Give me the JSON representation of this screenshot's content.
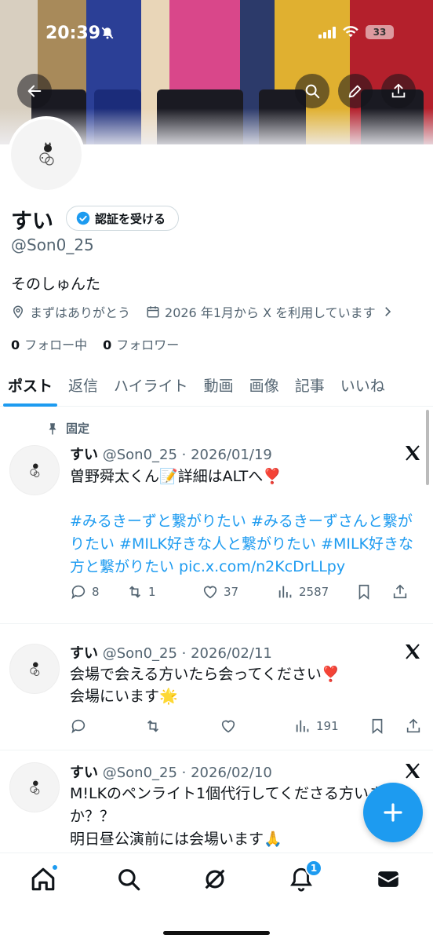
{
  "status": {
    "time": "20:39",
    "battery": "33"
  },
  "colors": {
    "accent": "#1d9bf0",
    "text": "#0f1419",
    "secondary": "#536471"
  },
  "profile": {
    "name": "すい",
    "verify_label": "認証を受ける",
    "handle": "@Son0_25",
    "bio": "そのしゅんた",
    "location": "まずはありがとう",
    "joined": "2026 年1月から X を利用しています",
    "following_count": "0",
    "following_label": "フォロー中",
    "followers_count": "0",
    "followers_label": "フォロワー"
  },
  "tabs": [
    {
      "label": "ポスト"
    },
    {
      "label": "返信"
    },
    {
      "label": "ハイライト"
    },
    {
      "label": "動画"
    },
    {
      "label": "画像"
    },
    {
      "label": "記事"
    },
    {
      "label": "いいね"
    }
  ],
  "posts": [
    {
      "pinned_label": "固定",
      "name": "すい",
      "handle_date": "@Son0_25 · 2026/01/19",
      "text": "曽野舜太くん📝詳細はALTへ❣️",
      "hashtags": "#みるきーずと繋がりたい #みるきーずさんと繋がりたい #MILK好きな人と繋がりたい #MILK好きな方と繋がりたい pic.x.com/n2KcDrLLpy",
      "replies": "8",
      "reposts": "1",
      "likes": "37",
      "views": "2587"
    },
    {
      "name": "すい",
      "handle_date": "@Son0_25 · 2026/02/11",
      "line1": "会場で会える方いたら会ってください❣️",
      "line2": "会場にいます🌟",
      "views": "191"
    },
    {
      "name": "すい",
      "handle_date": "@Son0_25 · 2026/02/10",
      "line1": "M!LKのペンライト1個代行してくださる方いませんか？？",
      "line2": "明日昼公演前には会場います🙏"
    }
  ],
  "bottom_nav": {
    "notification_count": "1"
  }
}
